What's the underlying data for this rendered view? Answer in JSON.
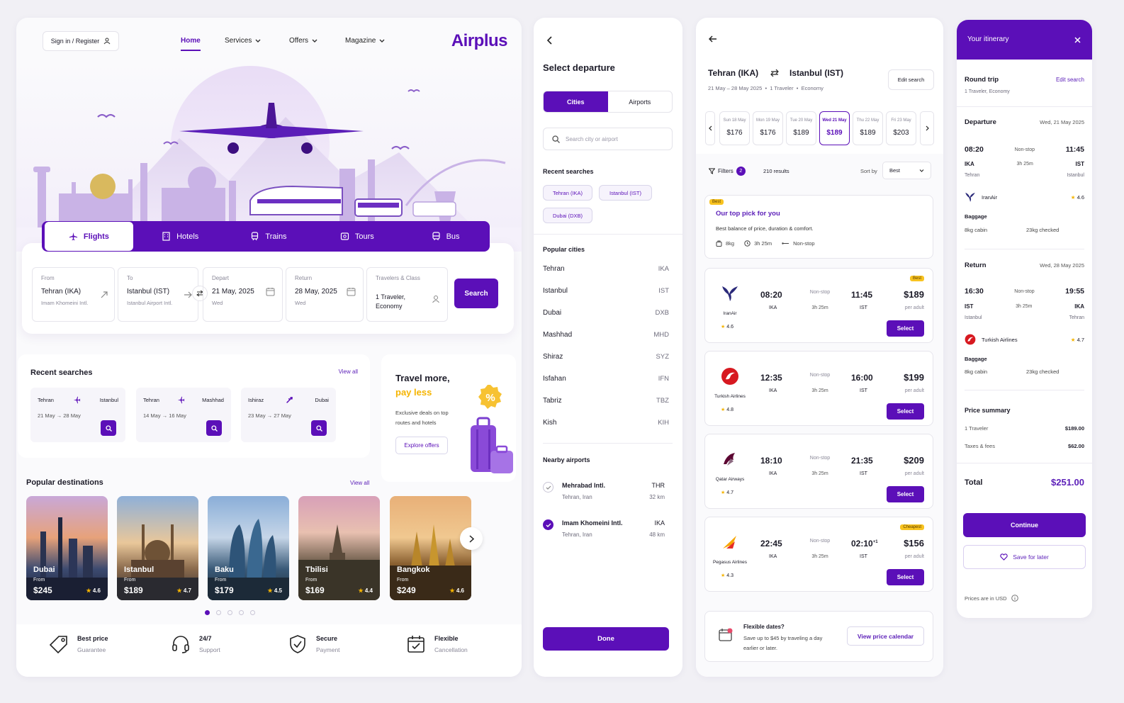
{
  "brand": "Airplus",
  "header": {
    "signin": "Sign in / Register",
    "nav": [
      "Home",
      "Services",
      "Offers",
      "Magazine"
    ]
  },
  "tabs": [
    "Flights",
    "Hotels",
    "Trains",
    "Tours",
    "Bus"
  ],
  "search": {
    "from": {
      "label": "From",
      "value": "Tehran (IKA)",
      "sub": "Imam Khomeini Intl."
    },
    "to": {
      "label": "To",
      "value": "Istanbul (IST)",
      "sub": "Istanbul Airport Intl."
    },
    "depart": {
      "label": "Depart",
      "value": "21 May, 2025",
      "sub": "Wed"
    },
    "return": {
      "label": "Return",
      "value": "28 May, 2025",
      "sub": "Wed"
    },
    "travelers": {
      "label": "Travelers & Class",
      "value": "1 Traveler, Economy"
    },
    "button": "Search"
  },
  "recent": {
    "title": "Recent searches",
    "view_all": "View all",
    "items": [
      {
        "from": "Tehran",
        "to": "Istanbul",
        "dates": "21 May → 28 May"
      },
      {
        "from": "Tehran",
        "to": "Mashhad",
        "dates": "14 May → 16 May"
      },
      {
        "from": "Ishiraz",
        "to": "Dubai",
        "dates": "23 May → 27 May"
      }
    ]
  },
  "promo": {
    "line1": "Travel more,",
    "line2": "pay less",
    "desc": "Exclusive deals on top routes and hotels",
    "button": "Explore offers"
  },
  "popular": {
    "title": "Popular destinations",
    "view_all": "View all",
    "from_label": "From",
    "items": [
      {
        "name": "Dubai",
        "price": "$245",
        "rating": "4.6"
      },
      {
        "name": "Istanbul",
        "price": "$189",
        "rating": "4.7"
      },
      {
        "name": "Baku",
        "price": "$179",
        "rating": "4.5"
      },
      {
        "name": "Tbilisi",
        "price": "$169",
        "rating": "4.4"
      },
      {
        "name": "Bangkok",
        "price": "$249",
        "rating": "4.6"
      }
    ]
  },
  "features": [
    {
      "title": "Best price",
      "sub": "Guarantee"
    },
    {
      "title": "24/7",
      "sub": "Support"
    },
    {
      "title": "Secure",
      "sub": "Payment"
    },
    {
      "title": "Flexible",
      "sub": "Cancellation"
    }
  ],
  "departure": {
    "title": "Select departure",
    "seg": [
      "Cities",
      "Airports"
    ],
    "search_placeholder": "Search city or airport",
    "recent_title": "Recent searches",
    "recent_chips": [
      "Tehran (IKA)",
      "Istanbul (IST)",
      "Dubai (DXB)"
    ],
    "popular_title": "Popular cities",
    "cities": [
      {
        "name": "Tehran",
        "code": "IKA"
      },
      {
        "name": "Istanbul",
        "code": "IST"
      },
      {
        "name": "Dubai",
        "code": "DXB"
      },
      {
        "name": "Mashhad",
        "code": "MHD"
      },
      {
        "name": "Shiraz",
        "code": "SYZ"
      },
      {
        "name": "Isfahan",
        "code": "IFN"
      },
      {
        "name": "Tabriz",
        "code": "TBZ"
      },
      {
        "name": "Kish",
        "code": "KIH"
      }
    ],
    "nearby_title": "Nearby airports",
    "nearby": [
      {
        "name": "Mehrabad Intl.",
        "loc": "Tehran, Iran",
        "code": "THR",
        "dist": "32 km"
      },
      {
        "name": "Imam Khomeini Intl.",
        "loc": "Tehran, Iran",
        "code": "IKA",
        "dist": "48 km"
      }
    ],
    "done": "Done"
  },
  "results": {
    "from": "Tehran (IKA)",
    "to": "Istanbul (IST)",
    "meta": "21 May – 28 May 2025  •  1 Traveler  •  Economy",
    "edit": "Edit search",
    "dates": [
      {
        "d": "Sun 18 May",
        "p": "$176"
      },
      {
        "d": "Mon 19 May",
        "p": "$176"
      },
      {
        "d": "Tue 20 May",
        "p": "$189"
      },
      {
        "d": "Wed 21 May",
        "p": "$189"
      },
      {
        "d": "Thu 22 May",
        "p": "$189"
      },
      {
        "d": "Fri 23 May",
        "p": "$203"
      }
    ],
    "filters": "Filters",
    "filters_count": "2",
    "count": "210 results",
    "sort_label": "Sort by",
    "sort_value": "Best",
    "top": {
      "badge": "Best",
      "title": "Our top pick for you",
      "desc": "Best balance of price, duration & comfort.",
      "bag": "8kg",
      "dur": "3h 25m",
      "stops": "Non-stop"
    },
    "flights": [
      {
        "airline": "IranAir",
        "rating": "4.6",
        "dep": "08:20",
        "from": "IKA",
        "arr": "11:45",
        "to": "IST",
        "stops": "Non-stop",
        "dur": "3h 25m",
        "price": "$189",
        "per": "per adult",
        "badge": "Best"
      },
      {
        "airline": "Turkish Airlines",
        "rating": "4.8",
        "dep": "12:35",
        "from": "IKA",
        "arr": "16:00",
        "to": "IST",
        "stops": "Non-stop",
        "dur": "3h 25m",
        "price": "$199",
        "per": "per adult",
        "badge": ""
      },
      {
        "airline": "Qatar Airways",
        "rating": "4.7",
        "dep": "18:10",
        "from": "IKA",
        "arr": "21:35",
        "to": "IST",
        "stops": "Non-stop",
        "dur": "3h 25m",
        "price": "$209",
        "per": "per adult",
        "badge": ""
      },
      {
        "airline": "Pegasus Airlines",
        "rating": "4.3",
        "dep": "22:45",
        "from": "IKA",
        "arr": "02:10",
        "arr_sup": "+1",
        "to": "IST",
        "stops": "Non-stop",
        "dur": "3h 25m",
        "price": "$156",
        "per": "per adult",
        "badge": "Cheapest"
      }
    ],
    "select": "Select",
    "flex": {
      "title": "Flexible dates?",
      "desc": "Save up to $45 by traveling a day earlier or later.",
      "button": "View price calendar"
    }
  },
  "itinerary": {
    "title": "Your itinerary",
    "trip": "Round trip",
    "edit": "Edit search",
    "trip_sub": "1 Traveler, Economy",
    "departure": {
      "label": "Departure",
      "date": "Wed, 21 May 2025",
      "dep": "08:20",
      "from": "IKA",
      "from_city": "Tehran",
      "arr": "11:45",
      "to": "IST",
      "to_city": "Istanbul",
      "stops": "Non-stop",
      "dur": "3h 25m",
      "airline": "IranAir",
      "rating": "4.6",
      "bag_label": "Baggage",
      "cabin": "8kg cabin",
      "checked": "23kg checked"
    },
    "return": {
      "label": "Return",
      "date": "Wed, 28 May 2025",
      "dep": "16:30",
      "from": "IST",
      "from_city": "Istanbul",
      "arr": "19:55",
      "to": "IKA",
      "to_city": "Tehran",
      "stops": "Non-stop",
      "dur": "3h 25m",
      "airline": "Turkish Airlines",
      "rating": "4.7",
      "bag_label": "Baggage",
      "cabin": "8kg cabin",
      "checked": "23kg checked"
    },
    "price_title": "Price summary",
    "traveler_label": "1 Traveler",
    "traveler_price": "$189.00",
    "taxes_label": "Taxes & fees",
    "taxes_price": "$62.00",
    "total_label": "Total",
    "total_price": "$251.00",
    "continue": "Continue",
    "save": "Save for later",
    "note": "Prices are in USD"
  },
  "colors": {
    "brand": "#5b0fb8",
    "accent": "#f5b400",
    "bg": "#f1f0f5"
  }
}
